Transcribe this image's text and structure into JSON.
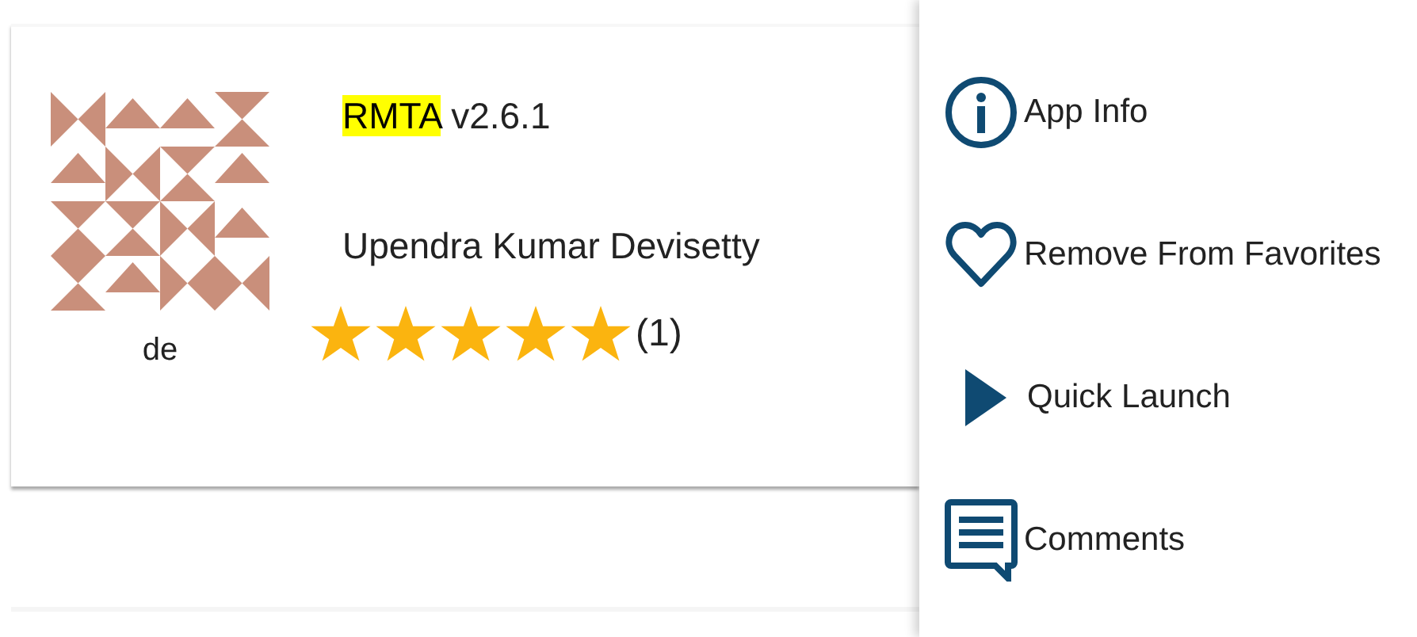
{
  "app": {
    "name": "RMTA",
    "name_highlighted": true,
    "version": "v2.6.1",
    "author": "Upendra Kumar Devisetty",
    "icon_caption": "de",
    "stars": 5,
    "rating_count": "(1)"
  },
  "menu": [
    {
      "kind": "info",
      "label": "App Info"
    },
    {
      "kind": "heart",
      "label": "Remove From Favorites"
    },
    {
      "kind": "play",
      "label": "Quick Launch"
    },
    {
      "kind": "comment",
      "label": "Comments"
    }
  ]
}
